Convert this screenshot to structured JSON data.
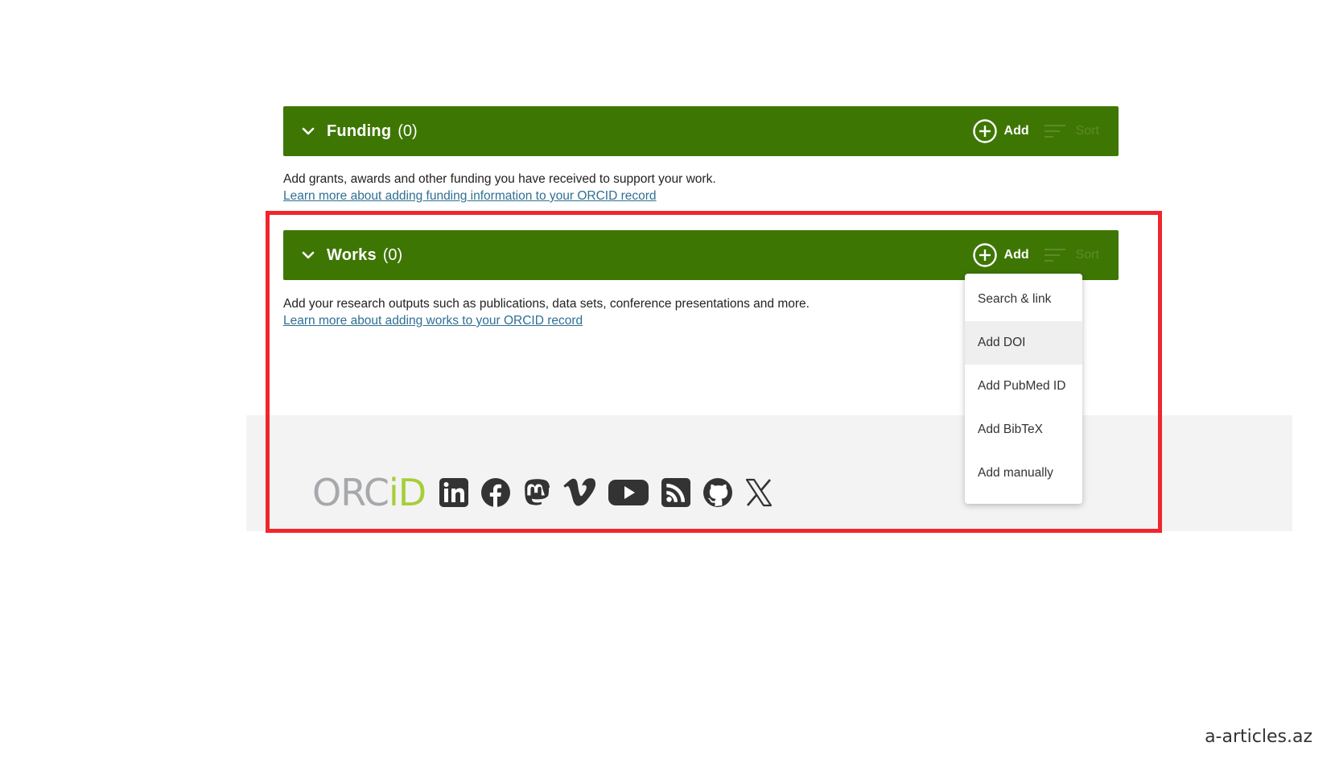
{
  "funding": {
    "title": "Funding",
    "count": "(0)",
    "add_label": "Add",
    "sort_label": "Sort",
    "description": "Add grants, awards and other funding you have received to support your work.",
    "learn_more": "Learn more about adding funding information to your ORCID record"
  },
  "works": {
    "title": "Works",
    "count": "(0)",
    "add_label": "Add",
    "sort_label": "Sort",
    "description": "Add your research outputs such as publications, data sets, conference presentations and more.",
    "learn_more": "Learn more about adding works to your ORCID record"
  },
  "add_menu": {
    "items": [
      {
        "label": "Search & link"
      },
      {
        "label": "Add DOI",
        "hovered": true
      },
      {
        "label": "Add PubMed ID"
      },
      {
        "label": "Add BibTeX"
      },
      {
        "label": "Add manually"
      }
    ]
  },
  "footer": {
    "logo_part1": "ORC",
    "logo_part2": "iD",
    "social_icons": [
      "linkedin-icon",
      "facebook-icon",
      "mastodon-icon",
      "vimeo-icon",
      "youtube-icon",
      "rss-icon",
      "github-icon",
      "x-icon"
    ]
  },
  "watermark": "a-articles.az",
  "colors": {
    "section_bar": "#3e7604",
    "highlight": "#f0262c",
    "logo_grey": "#a6a8ab",
    "logo_green": "#a6ce39",
    "link": "#2f6f93"
  }
}
